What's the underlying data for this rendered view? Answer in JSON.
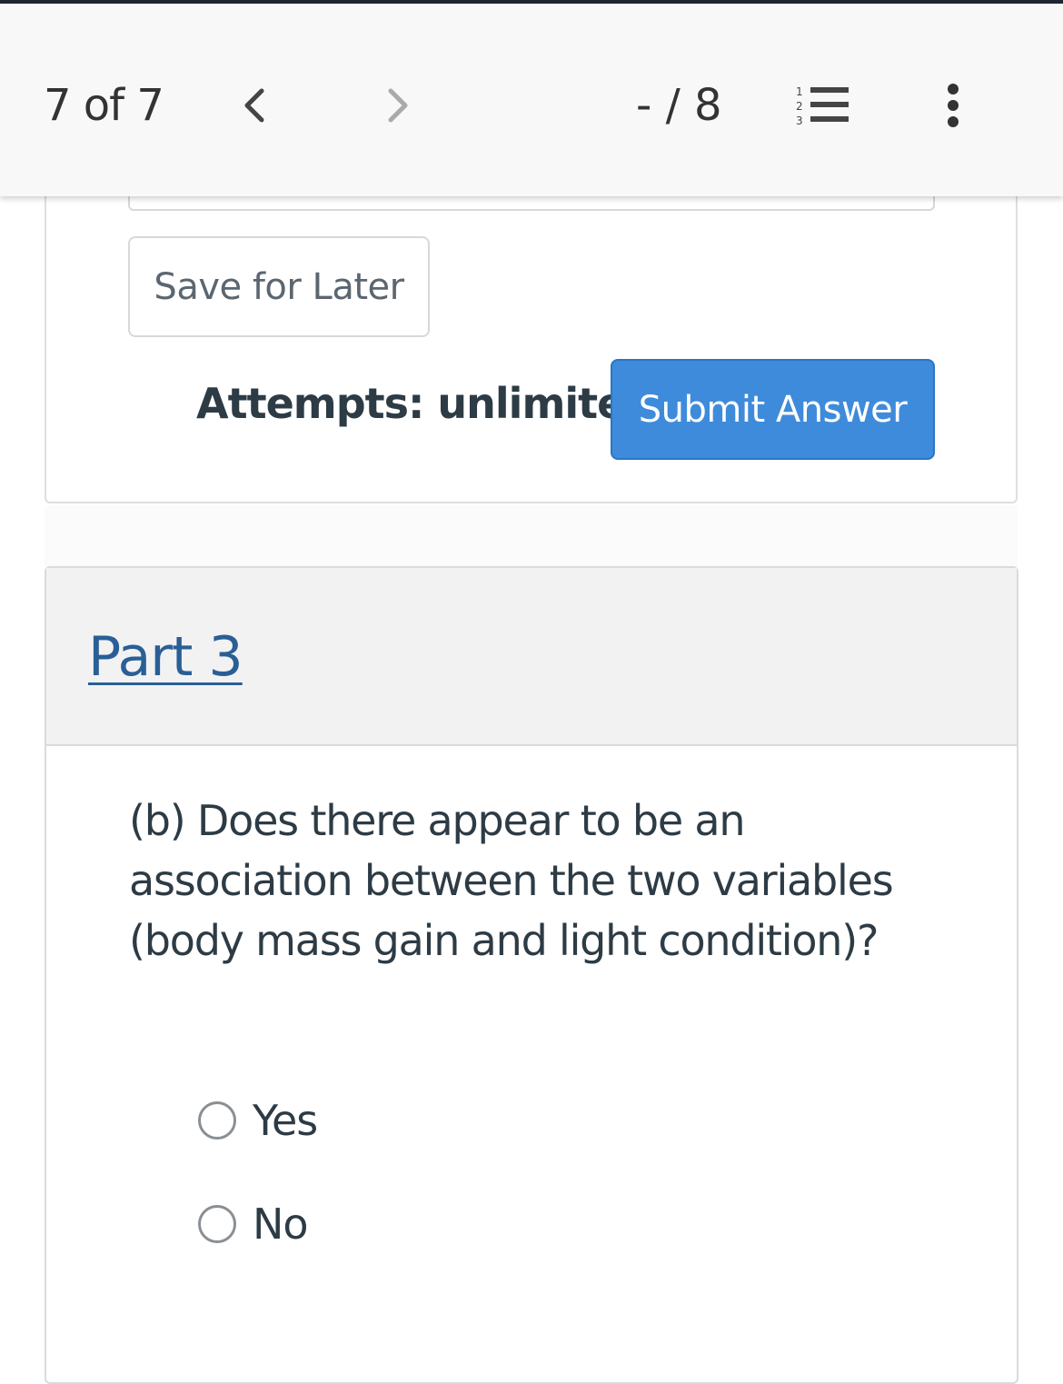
{
  "header": {
    "counter": "7 of 7",
    "score": "- / 8",
    "icons": {
      "prev": "chevron-left-icon",
      "next": "chevron-right-icon",
      "list": "numbered-list-icon",
      "more": "more-vertical-icon"
    }
  },
  "part2": {
    "save_label": "Save for Later",
    "attempts_label": "Attempts: unlimited",
    "submit_label": "Submit Answer"
  },
  "part3": {
    "title": "Part 3",
    "question": "(b) Does there appear to be an association between the two variables (body mass gain and light condition)?",
    "options": [
      {
        "label": "Yes",
        "selected": false
      },
      {
        "label": "No",
        "selected": false
      }
    ]
  },
  "colors": {
    "accent": "#3f8bdb",
    "link": "#2a5f96",
    "text": "#2d3b45"
  }
}
